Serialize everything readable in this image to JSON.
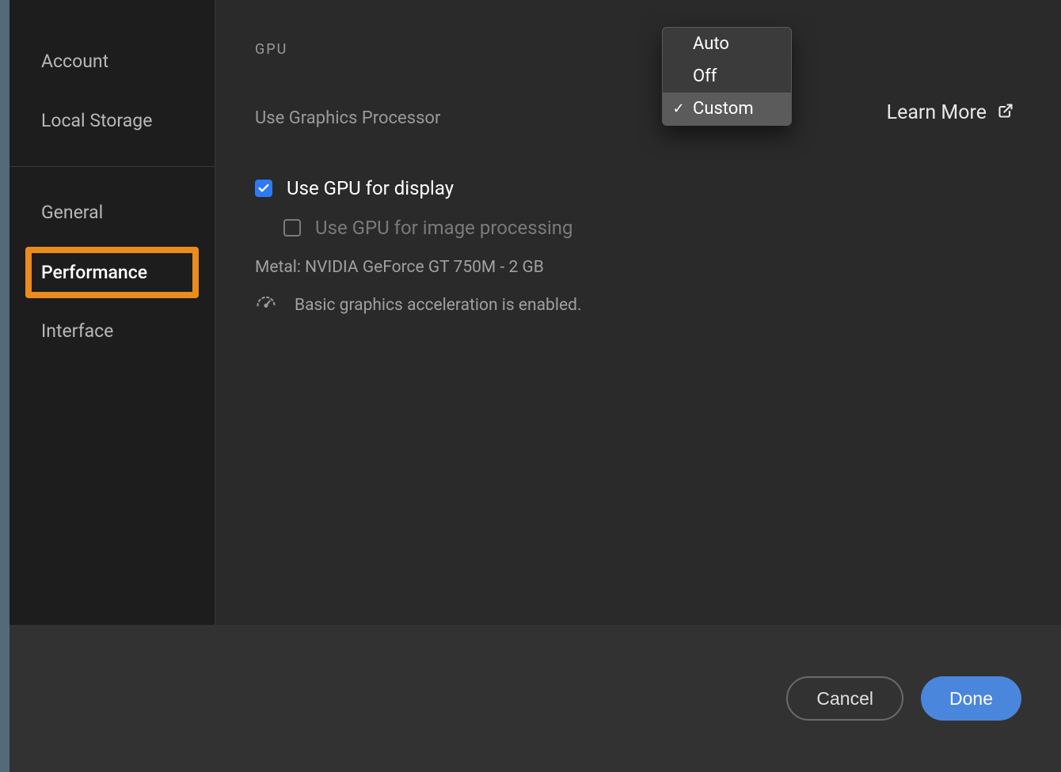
{
  "sidebar": {
    "items_top": [
      {
        "label": "Account"
      },
      {
        "label": "Local Storage"
      }
    ],
    "items_bottom": [
      {
        "label": "General"
      },
      {
        "label": "Performance"
      },
      {
        "label": "Interface"
      }
    ]
  },
  "main": {
    "section_heading": "GPU",
    "use_gp_label": "Use Graphics Processor",
    "learn_more": "Learn More",
    "dropdown": {
      "options": [
        {
          "label": "Auto"
        },
        {
          "label": "Off"
        },
        {
          "label": "Custom"
        }
      ],
      "selected": "Custom"
    },
    "cb_gpu_display": {
      "label": "Use GPU for display",
      "checked": true
    },
    "cb_gpu_image": {
      "label": "Use GPU for image processing",
      "checked": false
    },
    "gpu_info": "Metal: NVIDIA GeForce GT 750M - 2 GB",
    "status_text": "Basic graphics acceleration is enabled."
  },
  "footer": {
    "cancel": "Cancel",
    "done": "Done"
  }
}
